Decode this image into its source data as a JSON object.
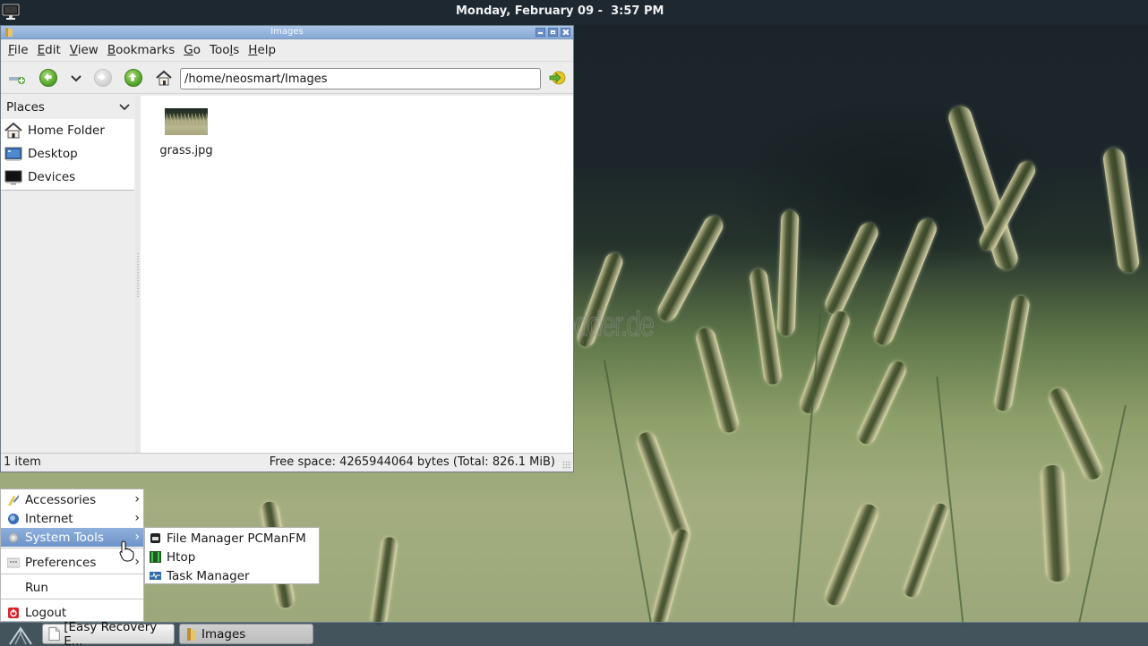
{
  "top_panel": {
    "clock": "Monday, February 09 -  3:57 PM"
  },
  "window": {
    "title": "Images",
    "menu": [
      {
        "label": "File",
        "mnemonic": "F",
        "rest": "ile"
      },
      {
        "label": "Edit",
        "mnemonic": "E",
        "rest": "dit"
      },
      {
        "label": "View",
        "mnemonic": "V",
        "rest": "iew"
      },
      {
        "label": "Bookmarks",
        "mnemonic": "B",
        "rest": "ookmarks"
      },
      {
        "label": "Go",
        "mnemonic": "G",
        "rest": "o"
      },
      {
        "label": "Tools",
        "pre": "Too",
        "mnemonic": "l",
        "rest": "s"
      },
      {
        "label": "Help",
        "mnemonic": "H",
        "rest": "elp"
      }
    ],
    "toolbar": {
      "location": "/home/neosmart/Images",
      "buttons": [
        "new-tab",
        "back",
        "history-dropdown",
        "forward",
        "up",
        "home",
        "go"
      ]
    },
    "sidebar": {
      "header": "Places",
      "items": [
        {
          "label": "Home Folder",
          "icon": "home-icon"
        },
        {
          "label": "Desktop",
          "icon": "desktop-icon"
        },
        {
          "label": "Devices",
          "icon": "devices-icon"
        }
      ]
    },
    "files": [
      {
        "name": "grass.jpg",
        "type": "image"
      }
    ],
    "status": {
      "count": "1 item",
      "free_space": "Free space: 4265944064 bytes (Total: 826.1 MiB)"
    }
  },
  "app_menu": {
    "items": [
      {
        "label": "Accessories",
        "has_submenu": true,
        "icon": "accessories-icon"
      },
      {
        "label": "Internet",
        "has_submenu": true,
        "icon": "internet-icon"
      },
      {
        "label": "System Tools",
        "has_submenu": true,
        "icon": "system-tools-icon",
        "active": true
      },
      {
        "label": "Preferences",
        "has_submenu": true,
        "icon": "preferences-icon"
      },
      {
        "label": "Run",
        "has_submenu": false
      },
      {
        "label": "Logout",
        "has_submenu": false,
        "icon": "logout-icon"
      }
    ],
    "arrow": "›",
    "submenu": [
      {
        "label": "File Manager PCManFM",
        "icon": "file-manager-icon"
      },
      {
        "label": "Htop",
        "icon": "htop-icon"
      },
      {
        "label": "Task Manager",
        "icon": "task-manager-icon"
      }
    ]
  },
  "taskbar": {
    "tasks": [
      {
        "label": "[Easy Recovery E...",
        "icon": "document-icon",
        "active": false
      },
      {
        "label": "Images",
        "icon": "folder-icon",
        "active": true
      }
    ]
  },
  "desktop": {
    "watermark": "Deskmodder.de"
  },
  "colors": {
    "titlebar": "#86a8d4",
    "menu_highlight": "#6d93c9",
    "top_panel": "#1d2831",
    "bottom_panel": "#374858"
  }
}
